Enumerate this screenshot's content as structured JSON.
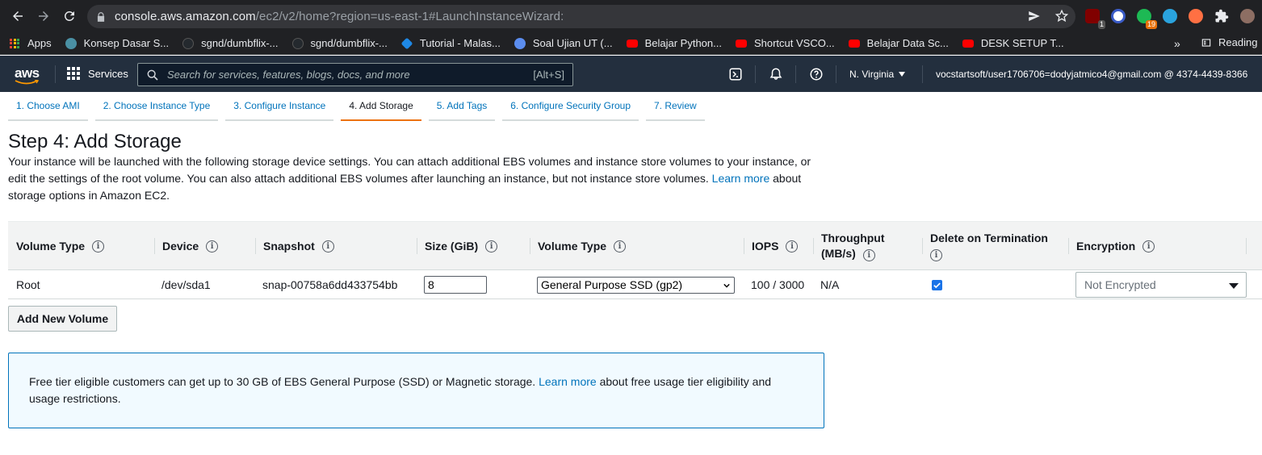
{
  "browser": {
    "url_host": "console.aws.amazon.com",
    "url_path": "/ec2/v2/home?region=us-east-1#LaunchInstanceWizard:",
    "extension_badges": [
      "1",
      "19"
    ]
  },
  "bookmarks": {
    "items": [
      {
        "label": "Apps",
        "icon": "apps-grid-icon",
        "color": "#ea4335"
      },
      {
        "label": "Konsep Dasar S...",
        "icon": "site-favicon",
        "color": "#4a90a4"
      },
      {
        "label": "sgnd/dumbflix-...",
        "icon": "github-icon",
        "color": "#24292e"
      },
      {
        "label": "sgnd/dumbflix-...",
        "icon": "github-icon",
        "color": "#24292e"
      },
      {
        "label": "Tutorial - Malas...",
        "icon": "diamond-icon",
        "color": "#1e88e5"
      },
      {
        "label": "Soal Ujian UT (...",
        "icon": "globe-icon",
        "color": "#5b8def"
      },
      {
        "label": "Belajar Python...",
        "icon": "youtube-icon",
        "color": "#ff0000"
      },
      {
        "label": "Shortcut VSCO...",
        "icon": "youtube-icon",
        "color": "#ff0000"
      },
      {
        "label": "Belajar Data Sc...",
        "icon": "youtube-icon",
        "color": "#ff0000"
      },
      {
        "label": "DESK SETUP T...",
        "icon": "youtube-icon",
        "color": "#ff0000"
      }
    ],
    "more": "»",
    "reading_list": "Reading"
  },
  "aws_header": {
    "logo": "aws",
    "services": "Services",
    "search_placeholder": "Search for services, features, blogs, docs, and more",
    "search_shortcut": "[Alt+S]",
    "region": "N. Virginia",
    "account": "vocstartsoft/user1706706=dodyjatmico4@gmail.com @ 4374-4439-8366"
  },
  "wizard": {
    "tabs": [
      {
        "label": "1. Choose AMI",
        "active": false
      },
      {
        "label": "2. Choose Instance Type",
        "active": false
      },
      {
        "label": "3. Configure Instance",
        "active": false
      },
      {
        "label": "4. Add Storage",
        "active": true
      },
      {
        "label": "5. Add Tags",
        "active": false
      },
      {
        "label": "6. Configure Security Group",
        "active": false
      },
      {
        "label": "7. Review",
        "active": false
      }
    ]
  },
  "page": {
    "title": "Step 4: Add Storage",
    "desc_before": "Your instance will be launched with the following storage device settings. You can attach additional EBS volumes and instance store volumes to your instance, or edit the settings of the root volume. You can also attach additional EBS volumes after launching an instance, but not instance store volumes. ",
    "desc_link": "Learn more",
    "desc_after": " about storage options in Amazon EC2."
  },
  "table": {
    "headers": {
      "volume_type": "Volume Type",
      "device": "Device",
      "snapshot": "Snapshot",
      "size": "Size (GiB)",
      "ebs_volume_type": "Volume Type",
      "iops": "IOPS",
      "throughput_1": "Throughput",
      "throughput_2": "(MB/s)",
      "delete_on_termination": "Delete on Termination",
      "encryption": "Encryption"
    },
    "row": {
      "volume_type": "Root",
      "device": "/dev/sda1",
      "snapshot": "snap-00758a6dd433754bb",
      "size": "8",
      "ebs_volume_type": "General Purpose SSD (gp2)",
      "iops": "100 / 3000",
      "throughput": "N/A",
      "delete_on_termination": true,
      "encryption": "Not Encrypted"
    },
    "add_button": "Add New Volume"
  },
  "info_box": {
    "text_before": "Free tier eligible customers can get up to 30 GB of EBS General Purpose (SSD) or Magnetic storage. ",
    "link": "Learn more",
    "text_after": " about free usage tier eligibility and usage restrictions."
  },
  "colors": {
    "aws_header_bg": "#232f3e",
    "link": "#0073bb",
    "active_tab_accent": "#ec7211",
    "info_box_bg": "#f1faff",
    "checkbox": "#1a73e8"
  }
}
